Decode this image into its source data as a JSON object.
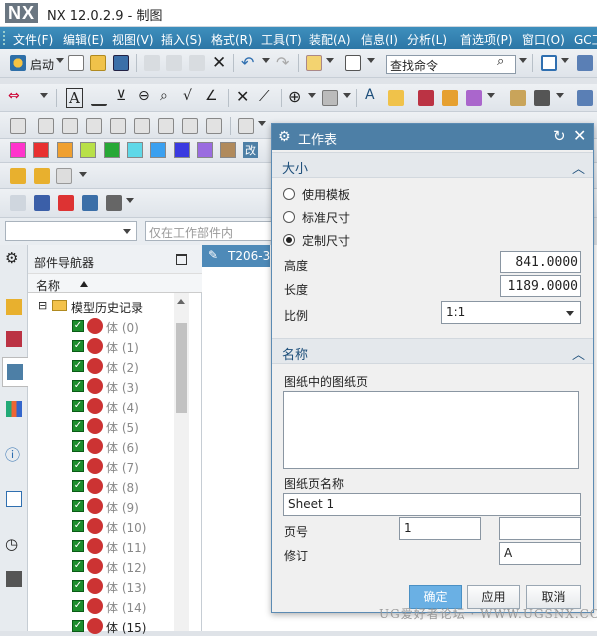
{
  "app": {
    "logo": "NX",
    "title": "NX 12.0.2.9 - 制图"
  },
  "menubar": [
    "文件(F)",
    "编辑(E)",
    "视图(V)",
    "插入(S)",
    "格式(R)",
    "工具(T)",
    "装配(A)",
    "信息(I)",
    "分析(L)",
    "首选项(P)",
    "窗口(O)",
    "GC工"
  ],
  "toolbar": {
    "start_label": "启动",
    "command_search": "查找命令"
  },
  "colors": {
    "accent": "#3a86b9",
    "dialog_title": "#4d7fa6",
    "ok_button": "#6ab0e4",
    "checkbox": "#1c8e2c"
  },
  "swatches": [
    "#ff33cc",
    "#e83030",
    "#f0a030",
    "#b8e048",
    "#27a836",
    "#5fd8e8",
    "#3aa0f0",
    "#3a3ae0",
    "#9a6ce0",
    "#b08a5c"
  ],
  "selection_bar": {
    "filter_value": "",
    "scope_placeholder": "仅在工作部件内"
  },
  "navigator": {
    "title": "部件导航器",
    "column": "名称",
    "root": "模型历史记录",
    "items": [
      "体 (0)",
      "体 (1)",
      "体 (2)",
      "体 (3)",
      "体 (4)",
      "体 (5)",
      "体 (6)",
      "体 (7)",
      "体 (8)",
      "体 (9)",
      "体 (10)",
      "体 (11)",
      "体 (12)",
      "体 (13)",
      "体 (14)",
      "体 (15)"
    ]
  },
  "drawing_tab": "T206-3",
  "dialog": {
    "title": "工作表",
    "size_section": "大小",
    "radio_options": [
      {
        "label": "使用模板",
        "selected": false
      },
      {
        "label": "标准尺寸",
        "selected": false
      },
      {
        "label": "定制尺寸",
        "selected": true
      }
    ],
    "height_label": "高度",
    "height_value": "841.0000",
    "length_label": "长度",
    "length_value": "1189.0000",
    "scale_label": "比例",
    "scale_value": "1:1",
    "name_section": "名称",
    "sheets_in_drawing_label": "图纸中的图纸页",
    "sheet_name_label": "图纸页名称",
    "sheet_name_value": "Sheet 1",
    "page_number_label": "页号",
    "page_number_value": "1",
    "page_number_extra": "",
    "revision_label": "修订",
    "revision_value": "A",
    "ok": "确定",
    "apply": "应用",
    "cancel": "取消"
  },
  "watermark": "UG爱好者论坛 · WWW.UGSNX.COM"
}
